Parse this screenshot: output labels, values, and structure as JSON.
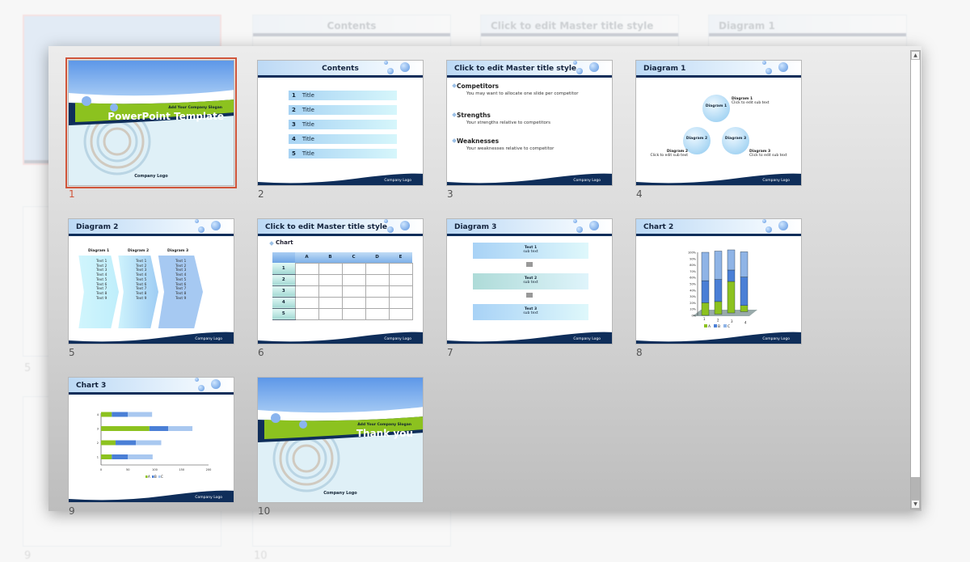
{
  "colors": {
    "accent_selected": "#d0553a",
    "navy": "#0f2e5a",
    "green": "#8cc21f",
    "light_blue": "#bcd9f5"
  },
  "scrollbar": {
    "up_icon": "▲",
    "down_icon": "▼"
  },
  "selected_slide": 1,
  "slides": [
    {
      "number": "1",
      "type": "cover",
      "slogan": "Add Your Company Slogan",
      "title": "PowerPoint Template",
      "logo": "Company Logo"
    },
    {
      "number": "2",
      "type": "contents",
      "title": "Contents",
      "items": [
        {
          "n": "1",
          "label": "Title"
        },
        {
          "n": "2",
          "label": "Title"
        },
        {
          "n": "3",
          "label": "Title"
        },
        {
          "n": "4",
          "label": "Title"
        },
        {
          "n": "5",
          "label": "Title"
        }
      ],
      "logo": "Company Logo"
    },
    {
      "number": "3",
      "type": "bullets",
      "title": "Click to edit Master title style",
      "items": [
        {
          "head": "Competitors",
          "text": "You may want to allocate one slide per competitor"
        },
        {
          "head": "Strengths",
          "text": "Your strengths relative to competitors"
        },
        {
          "head": "Weaknesses",
          "text": "Your weaknesses relative to competitor"
        }
      ],
      "logo": "Company Logo"
    },
    {
      "number": "4",
      "type": "diagram1",
      "title": "Diagram 1",
      "nodes": [
        {
          "label": "Diagram 1",
          "cap": "Diagram 1",
          "sub": "Click to edit sub text"
        },
        {
          "label": "Diagram 2",
          "cap": "Diagram 2",
          "sub": "Click to edit sub text"
        },
        {
          "label": "Diagram 3",
          "cap": "Diagram 3",
          "sub": "Click to edit sub text"
        }
      ],
      "logo": "Company Logo"
    },
    {
      "number": "5",
      "type": "diagram2",
      "title": "Diagram 2",
      "columns": [
        {
          "head": "Diagram 1",
          "lines": [
            "Text 1",
            "Text 2",
            "Text 3",
            "Text 4",
            "Text 5",
            "Text 6",
            "Text 7",
            "Text 8",
            "Text 9"
          ]
        },
        {
          "head": "Diagram 2",
          "lines": [
            "Text 1",
            "Text 2",
            "Text 3",
            "Text 4",
            "Text 5",
            "Text 6",
            "Text 7",
            "Text 8",
            "Text 9"
          ]
        },
        {
          "head": "Diagram 3",
          "lines": [
            "Text 1",
            "Text 2",
            "Text 3",
            "Text 4",
            "Text 5",
            "Text 6",
            "Text 7",
            "Text 8",
            "Text 9"
          ]
        }
      ],
      "logo": "Company Logo"
    },
    {
      "number": "6",
      "type": "table",
      "title": "Click to edit Master title style",
      "bullet": "Chart",
      "col_headers": [
        "A",
        "B",
        "C",
        "D",
        "E"
      ],
      "row_headers": [
        "1",
        "2",
        "3",
        "4",
        "5"
      ],
      "logo": "Company Logo"
    },
    {
      "number": "7",
      "type": "diagram3",
      "title": "Diagram 3",
      "boxes": [
        {
          "text": "Text 1",
          "sub": "sub text"
        },
        {
          "text": "Text 2",
          "sub": "sub text"
        },
        {
          "text": "Text 3",
          "sub": "sub text"
        }
      ],
      "logo": "Company Logo"
    },
    {
      "number": "8",
      "type": "chart2",
      "title": "Chart 2",
      "logo": "Company Logo"
    },
    {
      "number": "9",
      "type": "chart3",
      "title": "Chart 3",
      "logo": "Company Logo"
    },
    {
      "number": "10",
      "type": "cover",
      "slogan": "Add Your Company Slogan",
      "title": "Thank you",
      "logo": "Company Logo"
    }
  ],
  "chart_data": [
    {
      "slide": "8",
      "type": "bar",
      "stacked": "percent",
      "orientation": "vertical",
      "style": "3d-columns",
      "categories": [
        "1",
        "2",
        "3",
        "4"
      ],
      "series": [
        {
          "name": "A",
          "color": "#8cc21f",
          "values": [
            20,
            20,
            50,
            10
          ]
        },
        {
          "name": "B",
          "color": "#4a7fd6",
          "values": [
            35,
            35,
            18,
            45
          ]
        },
        {
          "name": "C",
          "color": "#8fb4e6",
          "values": [
            45,
            45,
            32,
            40
          ]
        }
      ],
      "yticks": [
        "0%",
        "10%",
        "20%",
        "30%",
        "40%",
        "50%",
        "60%",
        "70%",
        "80%",
        "90%",
        "100%"
      ],
      "ylim": [
        0,
        100
      ],
      "legend": "bottom"
    },
    {
      "slide": "9",
      "type": "bar",
      "stacked": true,
      "orientation": "horizontal",
      "categories": [
        "1",
        "2",
        "3",
        "4"
      ],
      "series": [
        {
          "name": "A",
          "color": "#8cc21f",
          "values": [
            20,
            27,
            90,
            20
          ]
        },
        {
          "name": "B",
          "color": "#4a7fd6",
          "values": [
            30,
            38,
            35,
            30
          ]
        },
        {
          "name": "C",
          "color": "#a9c8f0",
          "values": [
            46,
            47,
            45,
            45
          ]
        }
      ],
      "xticks": [
        "0",
        "50",
        "100",
        "150",
        "200"
      ],
      "xlim": [
        0,
        200
      ],
      "legend": "bottom"
    }
  ]
}
